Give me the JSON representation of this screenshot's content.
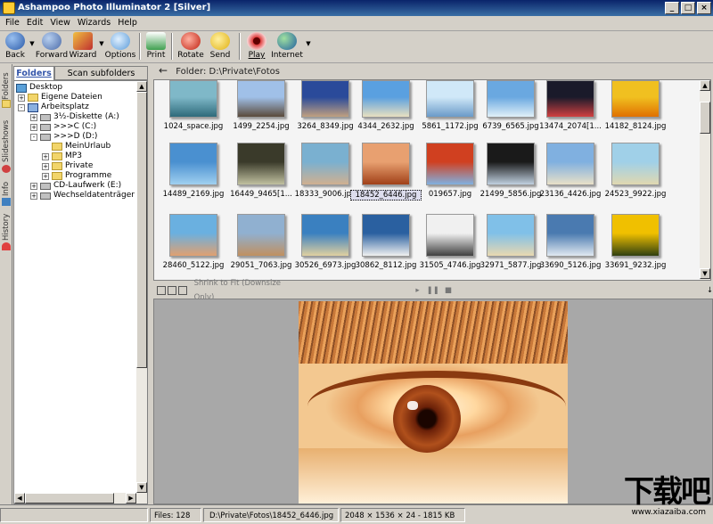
{
  "window": {
    "title": "Ashampoo Photo Illuminator 2 [Silver]"
  },
  "menu": [
    "File",
    "Edit",
    "View",
    "Wizards",
    "Help"
  ],
  "toolbar": {
    "back": "Back",
    "forward": "Forward",
    "wizard": "Wizard",
    "options": "Options",
    "print": "Print",
    "rotate": "Rotate",
    "send": "Send",
    "play": "Play",
    "internet": "Internet"
  },
  "side_tabs": {
    "folders": "Folders",
    "slideshows": "Slideshows",
    "info": "Info",
    "history": "History"
  },
  "folder_panel": {
    "tab_folders": "Folders",
    "tab_scan": "Scan subfolders",
    "tree": [
      {
        "label": "Desktop",
        "expander": "-"
      },
      {
        "label": "Eigene Dateien",
        "expander": "+"
      },
      {
        "label": "Arbeitsplatz",
        "expander": "-"
      },
      {
        "label": "3½-Diskette (A:)",
        "expander": "+"
      },
      {
        "label": ">>>C (C:)",
        "expander": "+"
      },
      {
        "label": ">>>D (D:)",
        "expander": "-"
      },
      {
        "label": "MeinUrlaub",
        "expander": ""
      },
      {
        "label": "MP3",
        "expander": "+"
      },
      {
        "label": "Private",
        "expander": "+"
      },
      {
        "label": "Programme",
        "expander": "+"
      },
      {
        "label": "CD-Laufwerk (E:)",
        "expander": "+"
      },
      {
        "label": "Wechseldatenträger (F:)",
        "expander": "+"
      }
    ]
  },
  "path": {
    "label": "Folder: D:\\Private\\Fotos"
  },
  "thumbnails": [
    {
      "name": "1024_space.jpg",
      "c1": "#7fb8c8",
      "c2": "#2e6a7a"
    },
    {
      "name": "1499_2254.jpg",
      "c1": "#a0c0e8",
      "c2": "#5a4a3a"
    },
    {
      "name": "3264_8349.jpg",
      "c1": "#2a4a9a",
      "c2": "#c0a080"
    },
    {
      "name": "4344_2632.jpg",
      "c1": "#5aa0e0",
      "c2": "#e8e0c0"
    },
    {
      "name": "5861_1172.jpg",
      "c1": "#d0e8f8",
      "c2": "#6a9ac8"
    },
    {
      "name": "6739_6565.jpg",
      "c1": "#6aa8e0",
      "c2": "#e0f0f8"
    },
    {
      "name": "13474_2074[1...",
      "c1": "#1a1a2a",
      "c2": "#d04040"
    },
    {
      "name": "14182_8124.jpg",
      "c1": "#f0c020",
      "c2": "#e07000"
    },
    {
      "name": "14489_2169.jpg",
      "c1": "#4a90d0",
      "c2": "#a0d0f0"
    },
    {
      "name": "16449_9465[1...",
      "c1": "#3a3a2a",
      "c2": "#c0c0a0"
    },
    {
      "name": "18333_9006.jpg",
      "c1": "#7ab0d0",
      "c2": "#d0b090"
    },
    {
      "name": "18452_6446.jpg",
      "c1": "#e8a070",
      "c2": "#a04018"
    },
    {
      "name": "019657.jpg",
      "c1": "#d04020",
      "c2": "#80b0e0"
    },
    {
      "name": "21499_5856.jpg",
      "c1": "#1a1a1a",
      "c2": "#c0d0e0"
    },
    {
      "name": "23136_4426.jpg",
      "c1": "#80b0e0",
      "c2": "#e8e0c8"
    },
    {
      "name": "24523_9922.jpg",
      "c1": "#a0d0e8",
      "c2": "#e0d8b0"
    },
    {
      "name": "28460_5122.jpg",
      "c1": "#6ab0e0",
      "c2": "#e0a070"
    },
    {
      "name": "29051_7063.jpg",
      "c1": "#90b0d0",
      "c2": "#c09060"
    },
    {
      "name": "30526_6973.jpg",
      "c1": "#3a80c0",
      "c2": "#e0d0a0"
    },
    {
      "name": "30862_8112.jpg",
      "c1": "#2a60a0",
      "c2": "#f0f0f0"
    },
    {
      "name": "31505_4746.jpg",
      "c1": "#f0f0f0",
      "c2": "#404040"
    },
    {
      "name": "32971_5877.jpg",
      "c1": "#80c0e8",
      "c2": "#e8d8b0"
    },
    {
      "name": "33690_5126.jpg",
      "c1": "#4a7ab0",
      "c2": "#e0e8f0"
    },
    {
      "name": "33691_9232.jpg",
      "c1": "#f0c000",
      "c2": "#304010"
    }
  ],
  "selected_index": 11,
  "viewer": {
    "zoom_label": "Shrink to Fit (Downsize Only)"
  },
  "status": {
    "files": "Files: 128",
    "path": "D:\\Private\\Fotos\\18452_6446.jpg",
    "info": "2048 × 1536 × 24 - 1815 KB"
  },
  "watermark": {
    "text": "下载吧",
    "url": "www.xiazaiba.com"
  }
}
